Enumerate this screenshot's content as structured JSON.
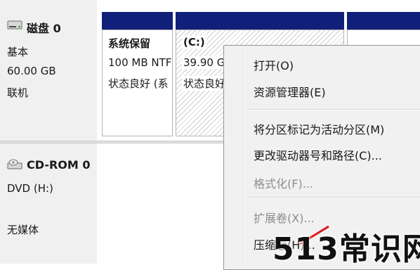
{
  "disk0": {
    "title": "磁盘 0",
    "type": "基本",
    "size": "60.00 GB",
    "status": "联机"
  },
  "cdrom0": {
    "title": "CD-ROM 0",
    "drive": "DVD (H:)",
    "media": "无媒体"
  },
  "partitions": [
    {
      "name": "系统保留",
      "size": "100 MB NTF",
      "status": "状态良好 (系"
    },
    {
      "name": "(C:)",
      "size": "39.90 GE",
      "status": "状态良好"
    }
  ],
  "colors": {
    "header": "#10207a",
    "menu_bg": "#f1f1f1",
    "label_bg": "#f0f0f0"
  },
  "context_menu": {
    "items": [
      {
        "label": "打开(O)",
        "enabled": true
      },
      {
        "label": "资源管理器(E)",
        "enabled": true
      },
      {
        "label": "将分区标记为活动分区(M)",
        "enabled": true
      },
      {
        "label": "更改驱动器号和路径(C)...",
        "enabled": true
      },
      {
        "label": "格式化(F)...",
        "enabled": false
      },
      {
        "label": "扩展卷(X)...",
        "enabled": false
      },
      {
        "label": "压缩卷(H)...",
        "enabled": true
      }
    ]
  },
  "watermark": "513常识网"
}
